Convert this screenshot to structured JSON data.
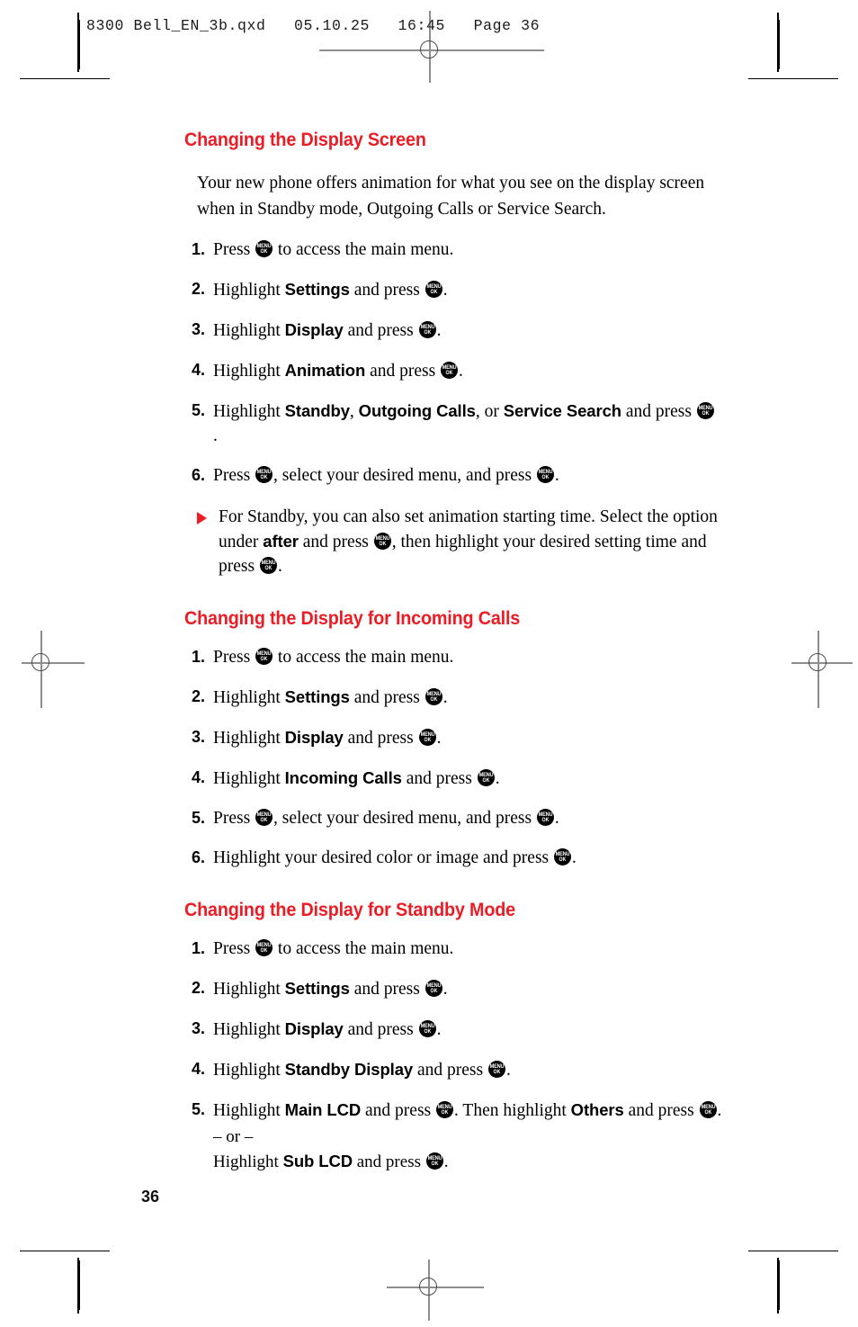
{
  "prepress": {
    "file_header": "8300 Bell_EN_3b.qxd   05.10.25   16:45   Page 36",
    "page_number": "36",
    "accent_red": "#ED1C24",
    "registration_icon": "registration-target-icon",
    "crop_icon": "crop-mark-icon"
  },
  "sections": [
    {
      "title": "Changing the Display Screen",
      "intro": "Your new phone offers animation for what you see on the display screen when in Standby mode, Outgoing Calls or Service Search.",
      "steps": [
        {
          "num": "1.",
          "p1": "Press ",
          "k1": true,
          "p2": " to access the main menu.",
          "k2": false,
          "p3": ""
        },
        {
          "num": "2.",
          "p1": "Highlight ",
          "kw1": "Settings",
          "p2": " and press ",
          "k2": true,
          "p3": "."
        },
        {
          "num": "3.",
          "p1": "Highlight ",
          "kw1": "Display",
          "p2": " and press ",
          "k2": true,
          "p3": "."
        },
        {
          "num": "4.",
          "p1": "Highlight ",
          "kw1": "Animation",
          "p2": " and press ",
          "k2": true,
          "p3": "."
        },
        {
          "num": "5.",
          "p1": "Highlight ",
          "kw1": "Standby",
          "sep1": ", ",
          "kw2": "Outgoing Calls",
          "sep2": ", or ",
          "kw3": "Service Search",
          "p2": " and press ",
          "k2": true,
          "p3": "."
        },
        {
          "num": "6.",
          "p1": "Press ",
          "k1": true,
          "p2": ", select your desired menu, and press ",
          "k2": true,
          "p3": "."
        }
      ],
      "note": {
        "bullet_icon": "triangle-bullet-icon",
        "t1": "For Standby, you can also set animation starting time. Select the option under ",
        "kw1": "after",
        "t2": " and press ",
        "t3": ", then highlight your desired setting time and press ",
        "t4": "."
      }
    },
    {
      "title": "Changing the Display for Incoming Calls",
      "steps": [
        {
          "num": "1.",
          "p1": "Press ",
          "k1": true,
          "p2": " to access the main menu.",
          "p3": ""
        },
        {
          "num": "2.",
          "p1": "Highlight ",
          "kw1": "Settings",
          "p2": " and press ",
          "k2": true,
          "p3": "."
        },
        {
          "num": "3.",
          "p1": "Highlight ",
          "kw1": "Display",
          "p2": " and press ",
          "k2": true,
          "p3": "."
        },
        {
          "num": "4.",
          "p1": "Highlight ",
          "kw1": "Incoming Calls",
          "p2": " and press ",
          "k2": true,
          "p3": "."
        },
        {
          "num": "5.",
          "p1": "Press ",
          "k1": true,
          "p2": ", select your desired menu, and press ",
          "k2": true,
          "p3": "."
        },
        {
          "num": "6.",
          "p1": "Highlight your desired color or image and press ",
          "k2": true,
          "p3": "."
        }
      ]
    },
    {
      "title": "Changing the Display for Standby Mode",
      "steps": [
        {
          "num": "1.",
          "p1": "Press ",
          "k1": true,
          "p2": " to access the main menu.",
          "p3": ""
        },
        {
          "num": "2.",
          "p1": "Highlight ",
          "kw1": "Settings",
          "p2": " and press ",
          "k2": true,
          "p3": "."
        },
        {
          "num": "3.",
          "p1": "Highlight ",
          "kw1": "Display",
          "p2": " and press ",
          "k2": true,
          "p3": "."
        },
        {
          "num": "4.",
          "p1": "Highlight ",
          "kw1": "Standby Display",
          "p2": " and press ",
          "k2": true,
          "p3": "."
        },
        {
          "num": "5.",
          "p1": "Highlight ",
          "kw1": "Main LCD",
          "p2": " and press ",
          "k2": true,
          "p3": ". Then highlight ",
          "kw2": "Others",
          "p4": " and press ",
          "p5": ".",
          "or_text": "– or –",
          "alt_p1": "Highlight ",
          "alt_kw": "Sub LCD",
          "alt_p2": " and press ",
          "alt_p3": "."
        }
      ]
    }
  ],
  "key_glyph": {
    "line1": "MENU",
    "line2": "OK"
  }
}
